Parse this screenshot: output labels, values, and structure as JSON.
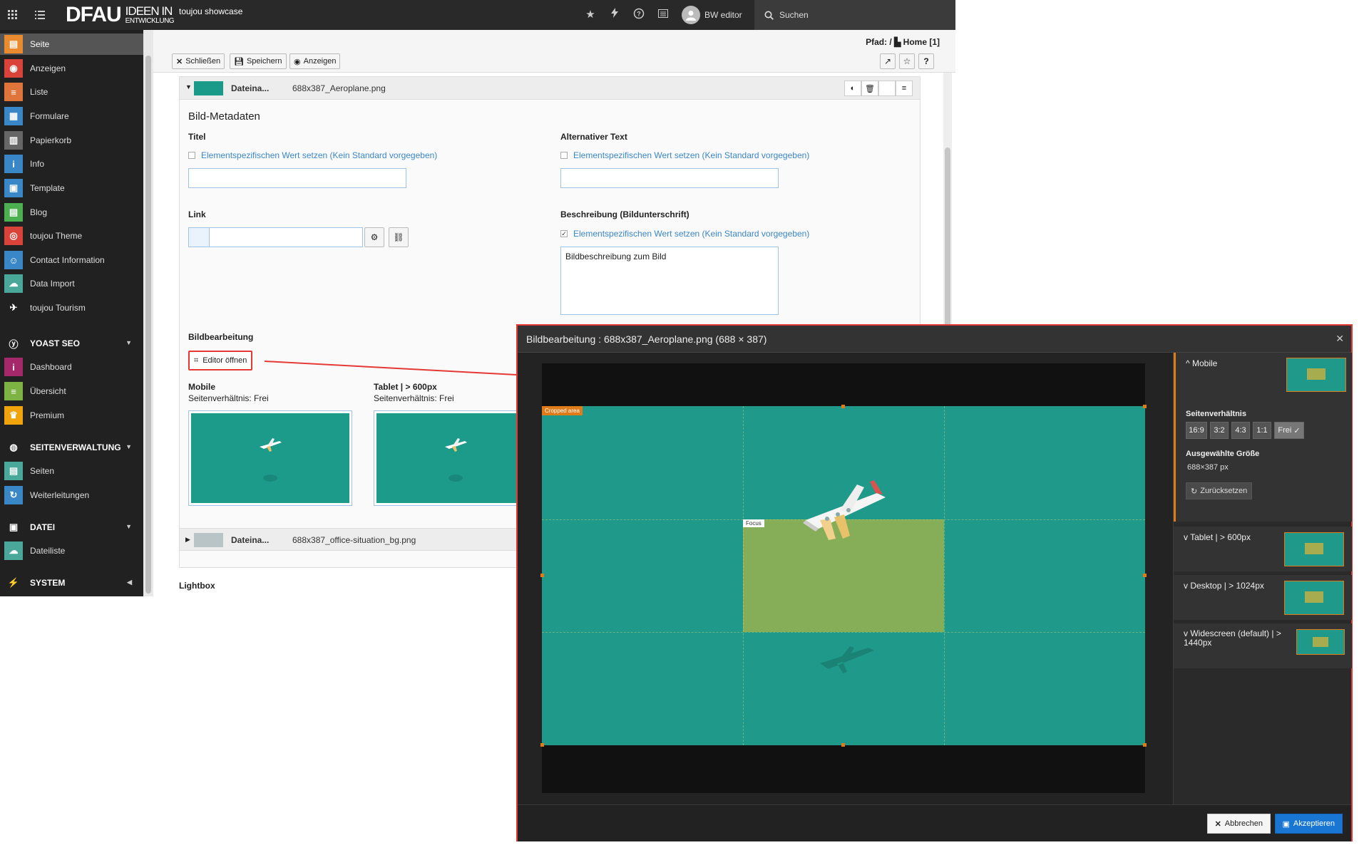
{
  "topbar": {
    "logo_main": "DFAU",
    "logo_sub_1": "IDEEN IN",
    "logo_sub_2": "ENTWICKLUNG",
    "site_name": "toujou showcase",
    "user_name": "BW editor",
    "search_label": "Suchen"
  },
  "sidebar": {
    "items": [
      {
        "label": "Seite",
        "color": "#e88a2d",
        "icon": "page-icon"
      },
      {
        "label": "Anzeigen",
        "color": "#d9433a",
        "icon": "eye-icon"
      },
      {
        "label": "Liste",
        "color": "#e0753c",
        "icon": "list-icon"
      },
      {
        "label": "Formulare",
        "color": "#3a87c8",
        "icon": "form-icon"
      },
      {
        "label": "Papierkorb",
        "color": "#666666",
        "icon": "trash-icon"
      },
      {
        "label": "Info",
        "color": "#3a87c8",
        "icon": "info-icon"
      },
      {
        "label": "Template",
        "color": "#3a87c8",
        "icon": "template-icon"
      },
      {
        "label": "Blog",
        "color": "#4caf50",
        "icon": "blog-icon"
      },
      {
        "label": "toujou Theme",
        "color": "#d9433a",
        "icon": "fingerprint-icon"
      },
      {
        "label": "Contact Information",
        "color": "#3a87c8",
        "icon": "contact-icon"
      },
      {
        "label": "Data Import",
        "color": "#4aa89b",
        "icon": "cloud-icon"
      },
      {
        "label": "toujou Tourism",
        "color": "#212121",
        "icon": "plane-icon"
      }
    ],
    "groups": [
      {
        "label": "YOAST SEO",
        "items": [
          {
            "label": "Dashboard",
            "color": "#a4286a",
            "icon": "dashboard-icon"
          },
          {
            "label": "Übersicht",
            "color": "#7cb342",
            "icon": "overview-icon"
          },
          {
            "label": "Premium",
            "color": "#f0a30a",
            "icon": "trophy-icon"
          }
        ]
      },
      {
        "label": "SEITENVERWALTUNG",
        "items": [
          {
            "label": "Seiten",
            "color": "#4aa89b",
            "icon": "pages-icon"
          },
          {
            "label": "Weiterleitungen",
            "color": "#3a87c8",
            "icon": "redirect-icon"
          }
        ]
      },
      {
        "label": "DATEI",
        "items": [
          {
            "label": "Dateiliste",
            "color": "#4aa89b",
            "icon": "filelist-icon"
          }
        ]
      },
      {
        "label": "SYSTEM",
        "items": []
      }
    ]
  },
  "docheader": {
    "path_prefix": "Pfad: /",
    "path_page": "Home [1]",
    "close_label": "Schließen",
    "save_label": "Speichern",
    "view_label": "Anzeigen"
  },
  "file_panel": {
    "label": "Dateina...",
    "filename": "688x387_Aeroplane.png",
    "metadata_title": "Bild-Metadaten",
    "title_label": "Titel",
    "alt_label": "Alternativer Text",
    "override_label": "Elementspezifischen Wert setzen (Kein Standard vorgegeben)",
    "link_label": "Link",
    "description_label": "Beschreibung (Bildunterschrift)",
    "description_value": "Bildbeschreibung zum Bild",
    "edit_section": "Bildbearbeitung",
    "editor_button": "Editor öffnen",
    "crop_variants": [
      {
        "name": "Mobile",
        "ratio": "Seitenverhältnis: Frei"
      },
      {
        "name": "Tablet | > 600px",
        "ratio": "Seitenverhältnis: Frei"
      }
    ]
  },
  "file_panel_2": {
    "label": "Dateina...",
    "filename": "688x387_office-situation_bg.png"
  },
  "lightbox_label": "Lightbox",
  "modal": {
    "title": "Bildbearbeitung : 688x387_Aeroplane.png (688 × 387)",
    "cropped_area": "Cropped area",
    "focus": "Focus",
    "variant_active": "Mobile",
    "aspect_label": "Seitenverhältnis",
    "ratios": [
      "16:9",
      "3:2",
      "4:3",
      "1:1",
      "Frei"
    ],
    "size_label": "Ausgewählte Größe",
    "size_value": "688×387 px",
    "reset_label": "Zurücksetzen",
    "variants": [
      "Tablet | > 600px",
      "Desktop | > 1024px",
      "Widescreen (default) | > 1440px"
    ],
    "cancel_label": "Abbrechen",
    "accept_label": "Akzeptieren"
  },
  "colors": {
    "image_teal": "#1f9a8a",
    "focus_green": "#86ad57",
    "crop_orange": "#e07b1a",
    "accept_blue": "#1976d2",
    "highlight_red": "#e53935"
  }
}
